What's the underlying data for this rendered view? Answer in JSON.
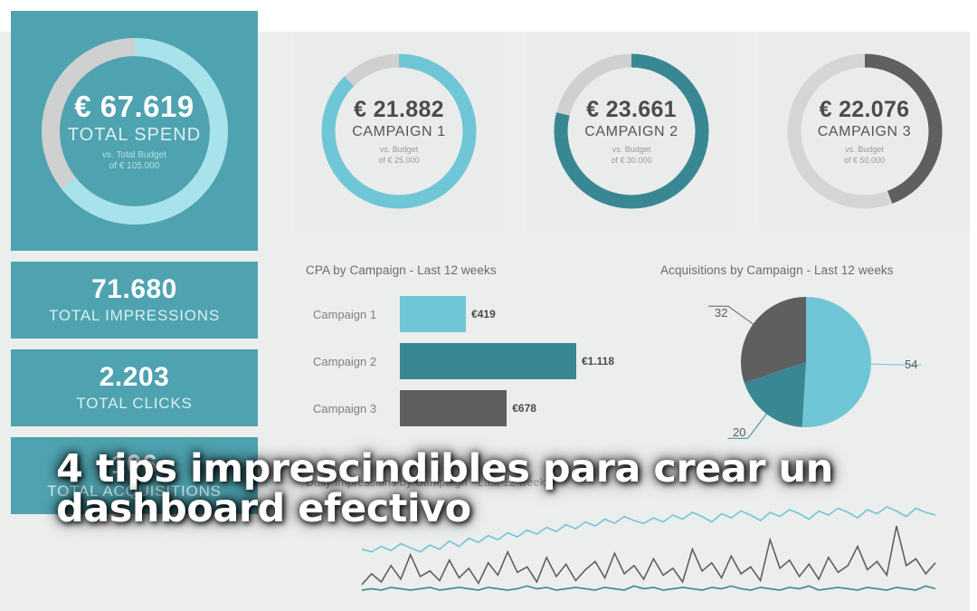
{
  "overlay": {
    "title_line1": "4 tips imprescindibles para crear un",
    "title_line2": "dashboard efectivo"
  },
  "colors": {
    "teal_card": "#4fa3b0",
    "light_teal": "#6fc6d6",
    "dark_teal": "#3a8794",
    "dark_gray": "#5f5f5f",
    "track_gray": "#cfd0d0",
    "panel_bg": "#eceded",
    "card_bg": "#eaebeb"
  },
  "kpis": {
    "hero": {
      "amount": "€ 67.619",
      "label": "TOTAL SPEND",
      "sub_line1": "vs. Total Budget",
      "sub_line2": "of € 105.000",
      "percent": 64.4
    },
    "cards": [
      {
        "value": "71.680",
        "label": "TOTAL IMPRESSIONS"
      },
      {
        "value": "2.203",
        "label": "TOTAL CLICKS"
      },
      {
        "value": "106",
        "label": "TOTAL ACQUISITIONS"
      }
    ]
  },
  "campaigns": [
    {
      "amount": "€ 21.882",
      "label": "CAMPAIGN 1",
      "sub_line1": "vs. Budget",
      "sub_line2": "of € 25.000",
      "percent": 87.5,
      "color": "#6fc6d6"
    },
    {
      "amount": "€ 23.661",
      "label": "CAMPAIGN 2",
      "sub_line1": "vs. Budget",
      "sub_line2": "of € 30.000",
      "percent": 78.9,
      "color": "#3a8794"
    },
    {
      "amount": "€ 22.076",
      "label": "CAMPAIGN 3",
      "sub_line1": "vs. Budget",
      "sub_line2": "of € 50.000",
      "percent": 44.2,
      "color": "#5f5f5f"
    }
  ],
  "chart_data": [
    {
      "type": "bar",
      "title": "CPA by Campaign - Last 12 weeks",
      "orientation": "horizontal",
      "categories": [
        "Campaign 1",
        "Campaign 2",
        "Campaign 3"
      ],
      "values": [
        419,
        1118,
        678
      ],
      "value_labels": [
        "€419",
        "€1.118",
        "€678"
      ],
      "colors": [
        "#6fc6d6",
        "#3a8794",
        "#5f5f5f"
      ],
      "xlabel": "",
      "ylabel": "",
      "xlim": [
        0,
        1250
      ],
      "grid": false,
      "legend": false
    },
    {
      "type": "pie",
      "title": "Acquisitions by Campaign - Last 12 weeks",
      "categories": [
        "Campaign 1",
        "Campaign 2",
        "Campaign 3"
      ],
      "values": [
        54,
        20,
        32
      ],
      "value_labels": [
        "54",
        "20",
        "32"
      ],
      "colors": [
        "#6fc6d6",
        "#3a8794",
        "#5f5f5f"
      ],
      "total": 106,
      "start_angle": 0,
      "legend": false
    },
    {
      "type": "line",
      "title": "Daily Impressions by Campaign - Last 12 weeks",
      "xlabel": "",
      "ylabel": "",
      "grid": false,
      "legend": false,
      "series": [
        {
          "name": "Campaign 1",
          "color": "#6fc6d6",
          "values": [
            38,
            36,
            40,
            37,
            42,
            39,
            36,
            41,
            38,
            44,
            40,
            46,
            43,
            48,
            45,
            50,
            47,
            52,
            49,
            54,
            51,
            56,
            53,
            58,
            55,
            60,
            57,
            62,
            59,
            57,
            61,
            58,
            63,
            60,
            65,
            62,
            58,
            64,
            61,
            66,
            63,
            59,
            65,
            62,
            67,
            64,
            60,
            66,
            63,
            68,
            65,
            61,
            67,
            64,
            69,
            66,
            62,
            68,
            65,
            63
          ]
        },
        {
          "name": "Campaign 3",
          "color": "#5f5f5f",
          "values": [
            12,
            20,
            14,
            26,
            16,
            34,
            18,
            22,
            15,
            30,
            17,
            24,
            13,
            28,
            19,
            36,
            21,
            25,
            14,
            32,
            18,
            27,
            15,
            23,
            29,
            17,
            35,
            20,
            26,
            16,
            31,
            19,
            24,
            14,
            38,
            22,
            28,
            17,
            33,
            20,
            25,
            15,
            45,
            24,
            30,
            18,
            27,
            16,
            32,
            21,
            26,
            40,
            23,
            29,
            19,
            55,
            26,
            31,
            20,
            28
          ]
        },
        {
          "name": "Campaign 2",
          "color": "#3a8794",
          "values": [
            8,
            9,
            8,
            10,
            9,
            8,
            9,
            10,
            8,
            9,
            10,
            9,
            8,
            10,
            9,
            8,
            9,
            11,
            9,
            10,
            8,
            9,
            10,
            9,
            8,
            10,
            9,
            8,
            11,
            9,
            10,
            8,
            9,
            10,
            9,
            8,
            10,
            9,
            11,
            9,
            8,
            10,
            9,
            8,
            10,
            9,
            11,
            8,
            9,
            10,
            9,
            8,
            10,
            9,
            8,
            10,
            9,
            8,
            11,
            9
          ]
        }
      ]
    }
  ]
}
